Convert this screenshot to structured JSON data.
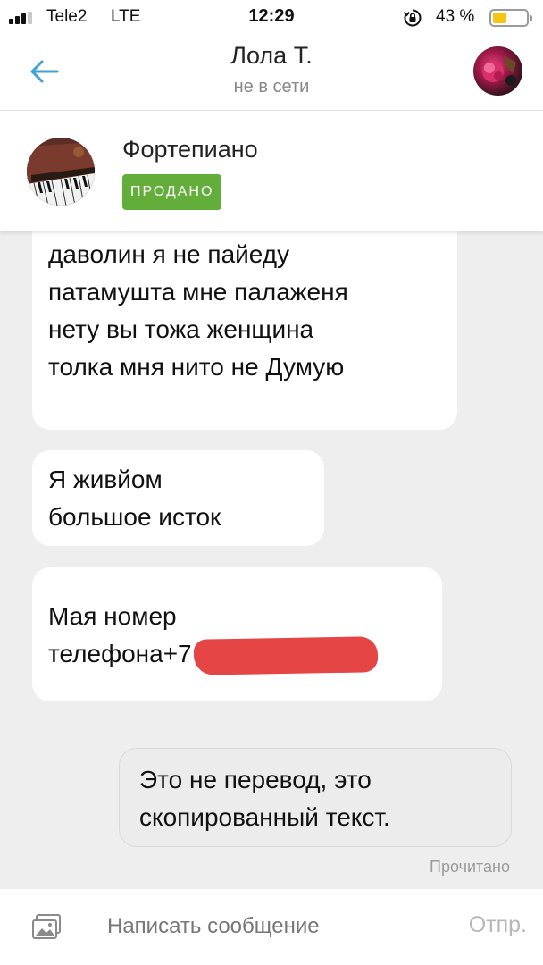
{
  "status_bar": {
    "carrier": "Tele2",
    "network": "LTE",
    "time": "12:29",
    "battery_percent": "43 %",
    "battery_level": 0.43,
    "signal_bars_filled": 3,
    "signal_bars_total": 4,
    "icons": [
      "signal-icon",
      "rotation-lock-icon",
      "battery-icon"
    ],
    "battery_color": "#f5c511"
  },
  "header": {
    "contact_name": "Лола Т.",
    "contact_status": "не в сети",
    "back_icon": "arrow-left-icon",
    "accent_color": "#3fa2d6"
  },
  "listing": {
    "title": "Фортепиано",
    "status_badge": "ПРОДАНО",
    "badge_color": "#63ad3a"
  },
  "messages": [
    {
      "direction": "incoming",
      "text": "даволин я не пайеду\nпатамушта мне палаженя\nнету вы тожа женщина\nтолка мня нито не Думую"
    },
    {
      "direction": "incoming",
      "text": "Я живйом\nбольшое исток"
    },
    {
      "direction": "incoming",
      "text": "Мая номер\nтелефона+7",
      "redacted": true
    },
    {
      "direction": "outgoing",
      "text": "Это не перевод, это\nскопированный текст."
    }
  ],
  "read_receipt": "Прочитано",
  "composer": {
    "placeholder": "Написать сообщение",
    "value": "",
    "send_label": "Отпр.",
    "attach_icon": "image-attach-icon"
  }
}
